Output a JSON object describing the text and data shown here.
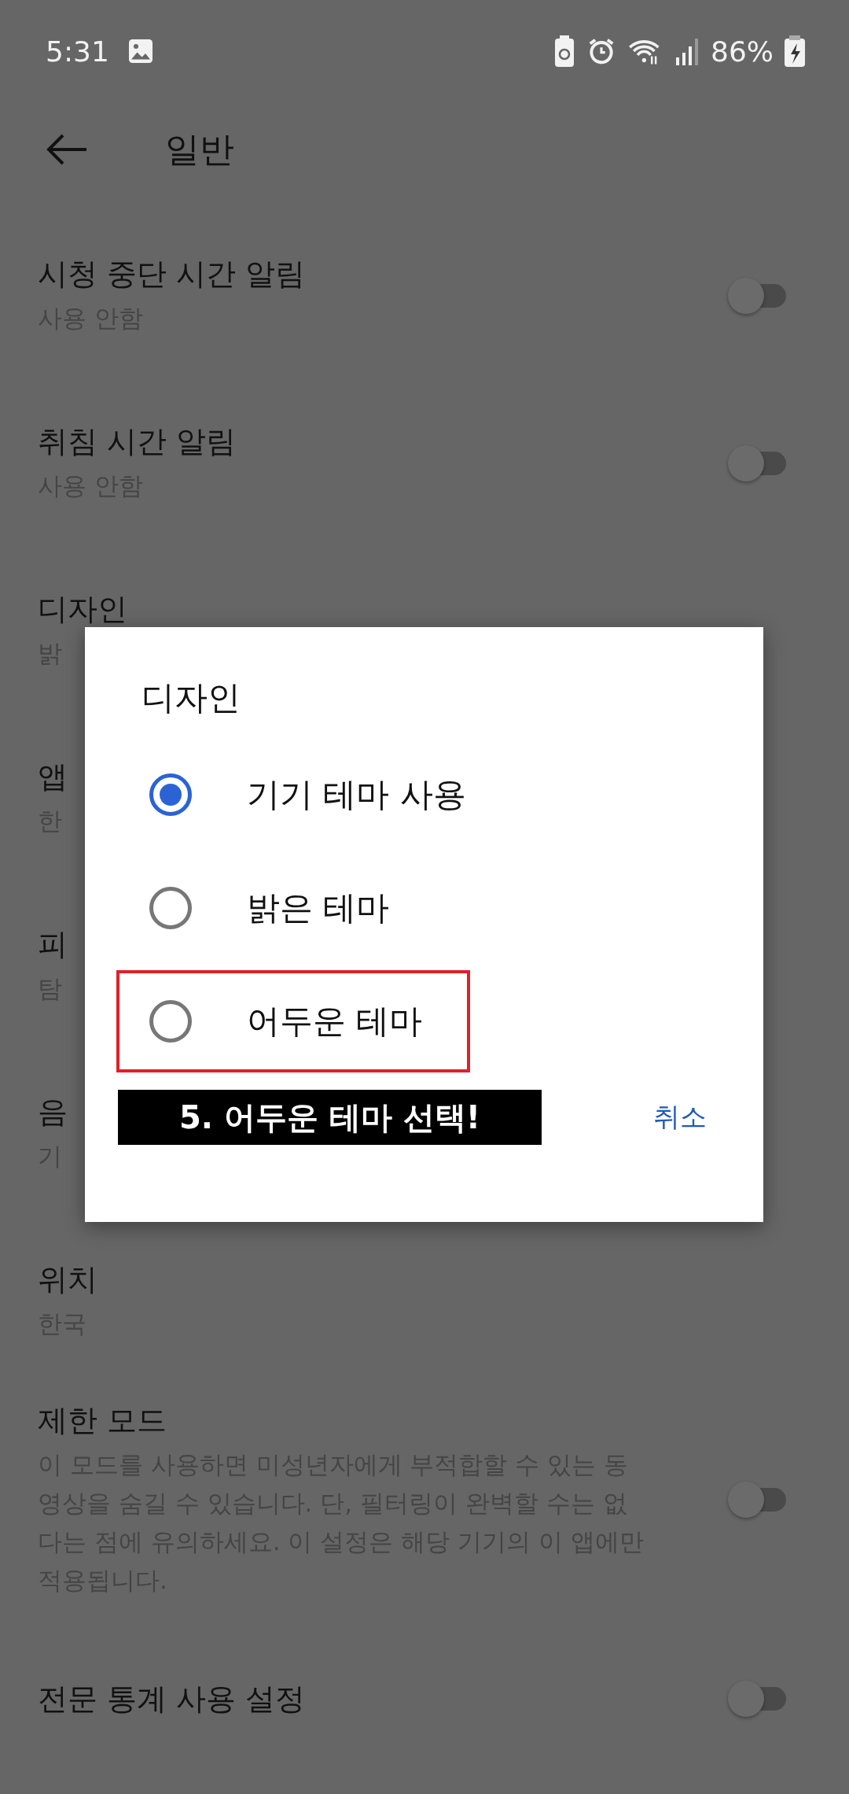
{
  "status_bar": {
    "time": "5:31",
    "battery": "86%"
  },
  "header": {
    "title": "일반"
  },
  "settings": [
    {
      "title": "시청 중단 시간 알림",
      "subtitle": "사용 안함",
      "kind": "switch",
      "on": false
    },
    {
      "title": "취침 시간 알림",
      "subtitle": "사용 안함",
      "kind": "switch",
      "on": false
    },
    {
      "title": "디자인",
      "subtitle": "밝",
      "kind": "text"
    },
    {
      "title": "앱",
      "subtitle": "한",
      "kind": "text"
    },
    {
      "title": "피",
      "subtitle": "탐",
      "kind": "text"
    },
    {
      "title": "음",
      "subtitle": "기",
      "kind": "text"
    },
    {
      "title": "위치",
      "subtitle": "한국",
      "kind": "text"
    },
    {
      "title": "제한 모드",
      "subtitle": "이 모드를 사용하면 미성년자에게 부적합할 수 있는 동영상을 숨길 수 있습니다. 단, 필터링이 완벽할 수는 없다는 점에 유의하세요. 이 설정은 해당 기기의 이 앱에만 적용됩니다.",
      "kind": "switch",
      "on": false
    },
    {
      "title": "전문 통계 사용 설정",
      "kind": "switch",
      "on": false
    }
  ],
  "dialog": {
    "title": "디자인",
    "options": [
      {
        "label": "기기 테마 사용",
        "selected": true,
        "highlighted": false
      },
      {
        "label": "밝은 테마",
        "selected": false,
        "highlighted": false
      },
      {
        "label": "어두운 테마",
        "selected": false,
        "highlighted": true
      }
    ],
    "annotation": "5. 어두운 테마 선택!",
    "cancel": "취소"
  }
}
